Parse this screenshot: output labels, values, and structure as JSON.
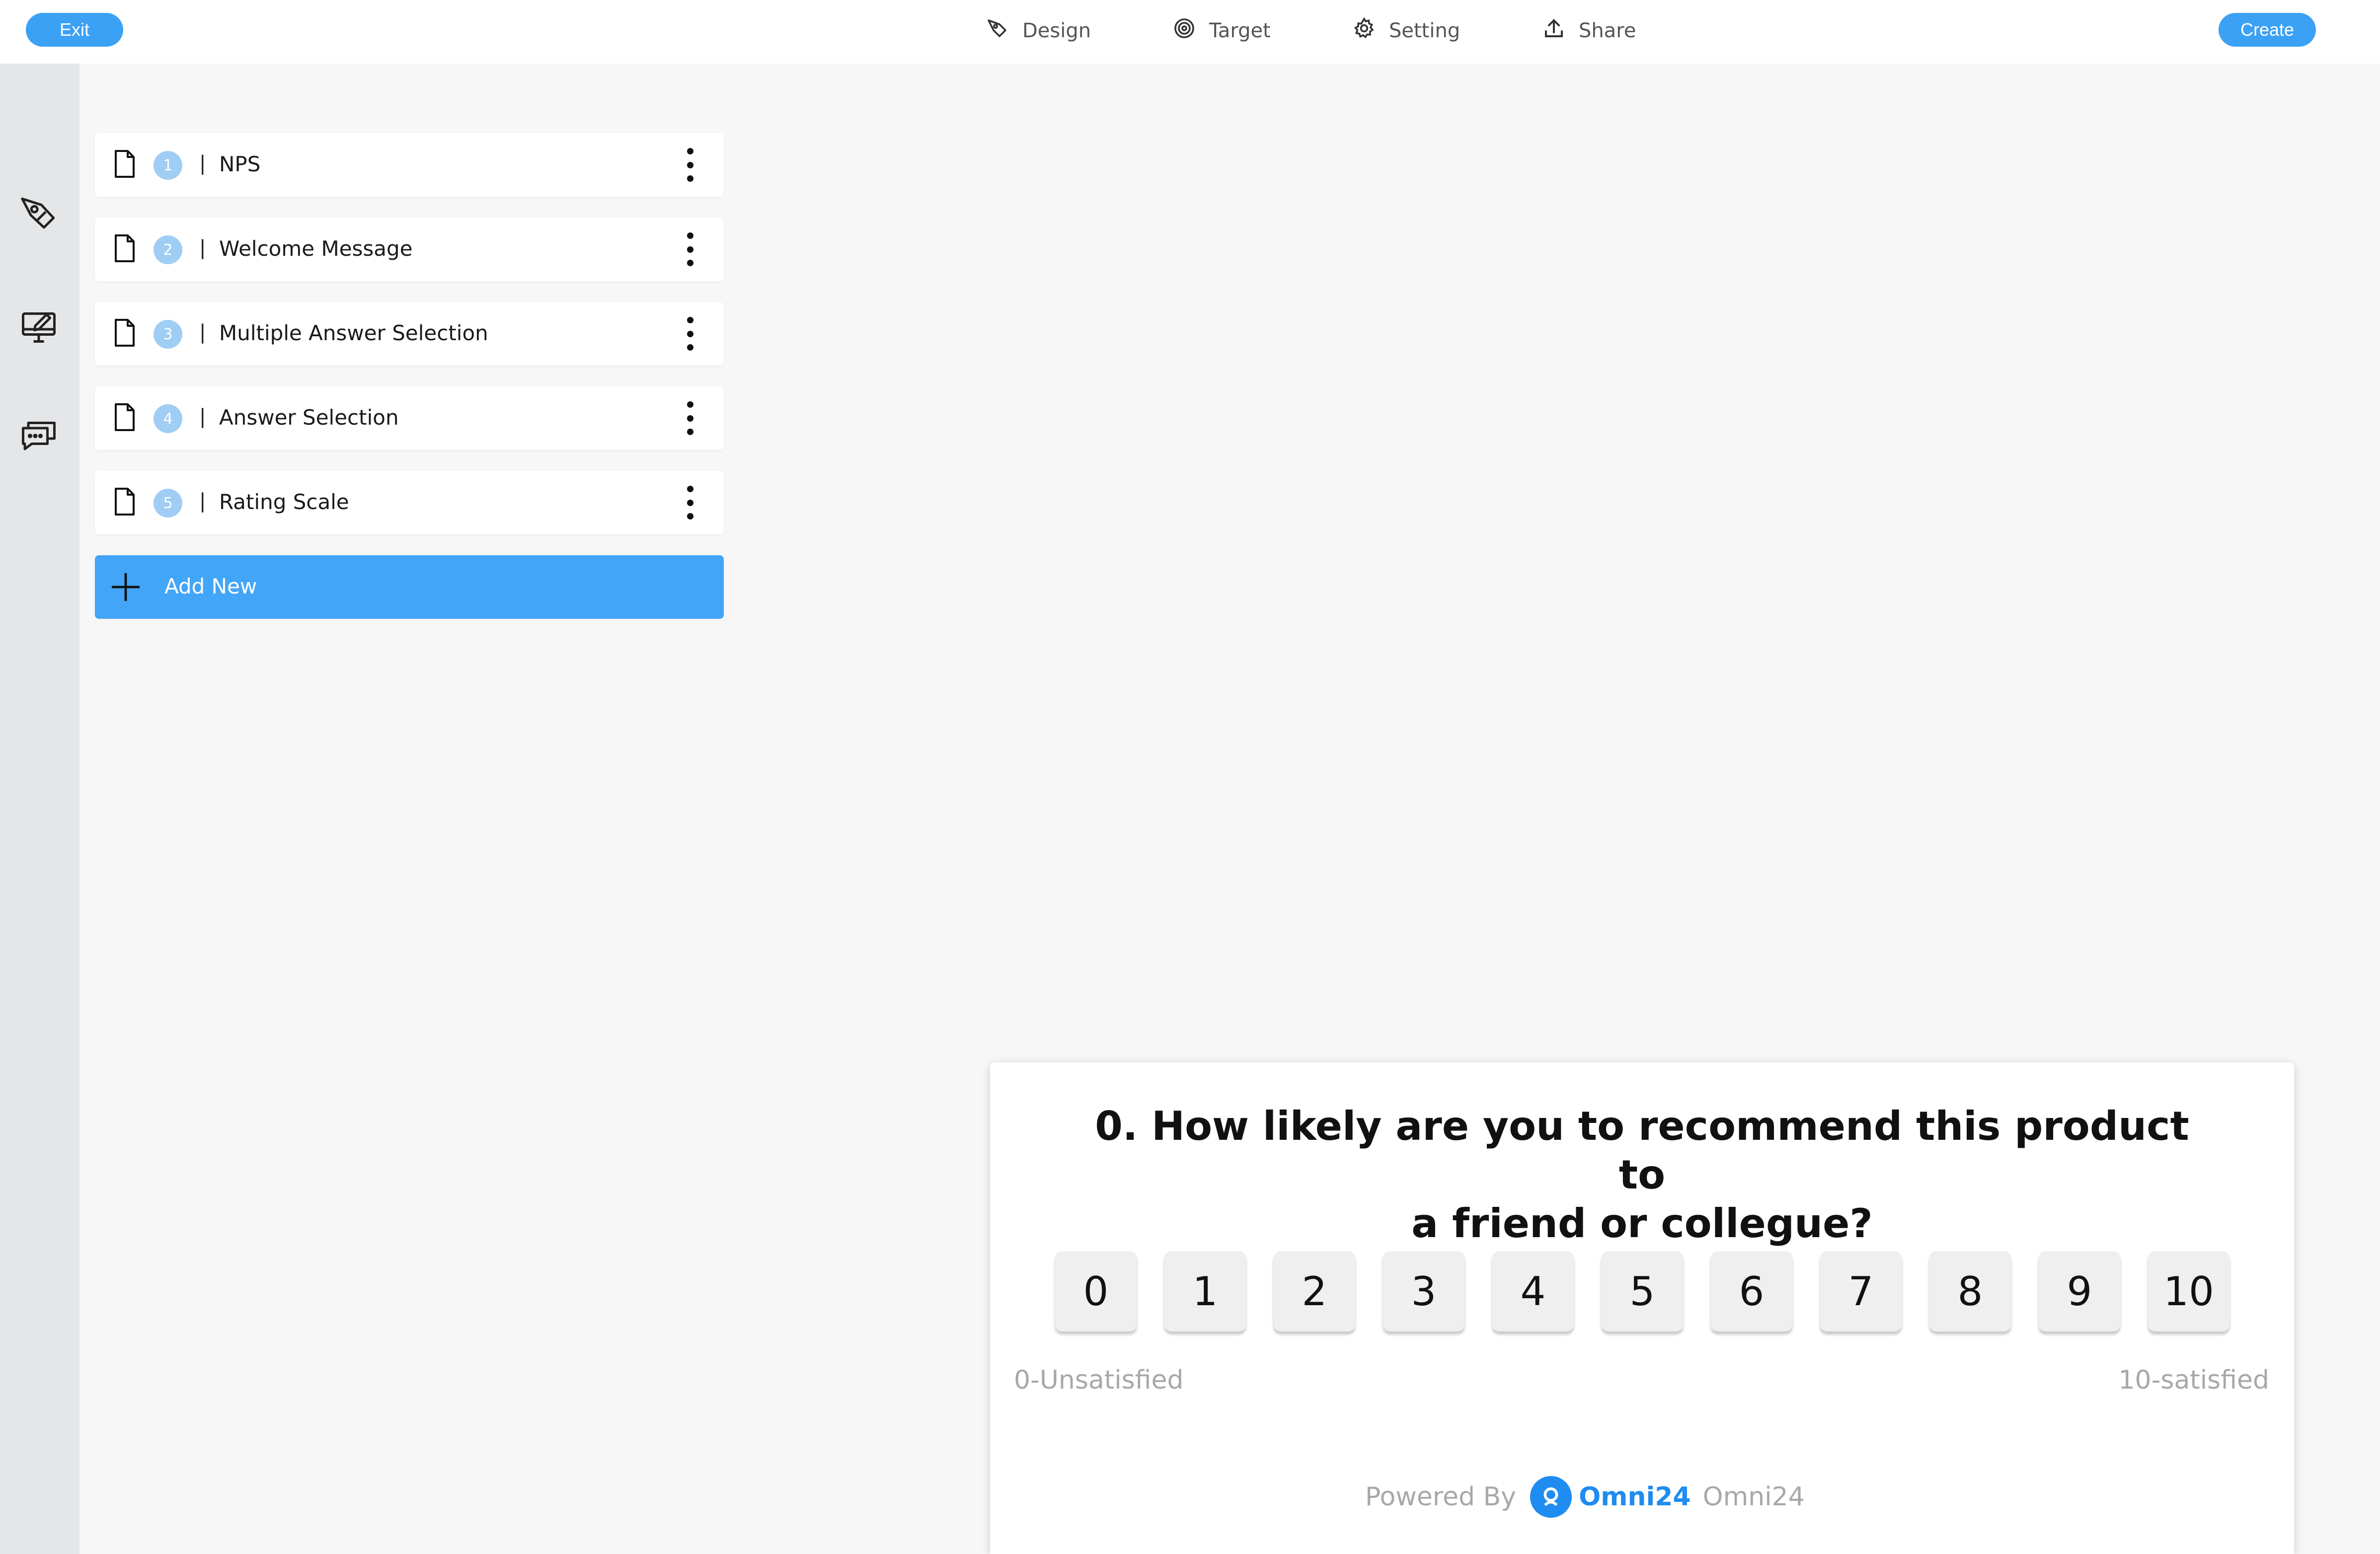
{
  "topbar": {
    "exit_label": "Exit",
    "create_label": "Create",
    "nav": [
      {
        "label": "Design",
        "icon": "pen-icon"
      },
      {
        "label": "Target",
        "icon": "target-icon"
      },
      {
        "label": "Setting",
        "icon": "gear-icon"
      },
      {
        "label": "Share",
        "icon": "share-upload-icon"
      }
    ],
    "accent_color": "#3ba1f5"
  },
  "rail": {
    "icons": [
      "pen-nib-icon",
      "monitor-edit-icon",
      "chat-bubbles-icon"
    ]
  },
  "questions": [
    {
      "number": "1",
      "separator": "|",
      "label": "NPS"
    },
    {
      "number": "2",
      "separator": "|",
      "label": "Welcome Message"
    },
    {
      "number": "3",
      "separator": "|",
      "label": "Multiple Answer Selection"
    },
    {
      "number": "4",
      "separator": "|",
      "label": "Answer Selection"
    },
    {
      "number": "5",
      "separator": "|",
      "label": "Rating Scale"
    }
  ],
  "add_new": {
    "label": "Add New",
    "color": "#43a5f7"
  },
  "preview": {
    "question_line1": "0. How likely are you to recommend this product to",
    "question_line2": "a friend or collegue?",
    "scores": [
      "0",
      "1",
      "2",
      "3",
      "4",
      "5",
      "6",
      "7",
      "8",
      "9",
      "10"
    ],
    "scale_left": "0-Unsatisfied",
    "scale_right": "10-satisfied",
    "powered_by": "Powered By",
    "brand": "Omni24",
    "brand_suffix": "Omni24",
    "brand_color": "#1e8cf0"
  }
}
